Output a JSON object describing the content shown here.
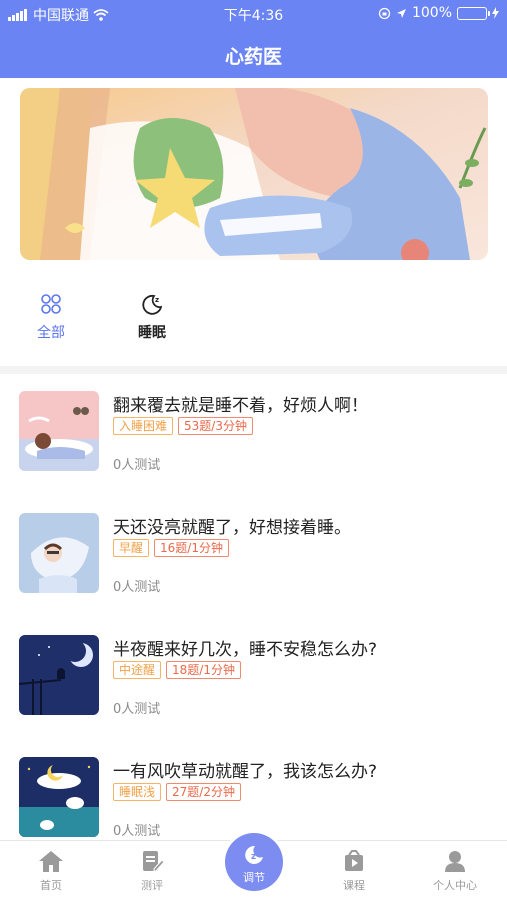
{
  "status_bar": {
    "carrier": "中国联通",
    "time": "下午4:36",
    "battery_percent": "100%",
    "battery_level": 1.0
  },
  "header": {
    "title": "心药医"
  },
  "categories": [
    {
      "label": "全部",
      "icon": "grid-icon",
      "active": true
    },
    {
      "label": "睡眠",
      "icon": "moon-icon",
      "active": false
    }
  ],
  "tests": [
    {
      "title": "翻来覆去就是睡不着，好烦人啊！",
      "tag": "入睡困难",
      "meta": "53题/3分钟",
      "takers": "0人测试",
      "thumb": "girl-sleeping"
    },
    {
      "title": "天还没亮就醒了，好想接着睡。",
      "tag": "早醒",
      "meta": "16题/1分钟",
      "takers": "0人测试",
      "thumb": "pillow"
    },
    {
      "title": "半夜醒来好几次，睡不安稳怎么办?",
      "tag": "中途醒",
      "meta": "18题/1分钟",
      "takers": "0人测试",
      "thumb": "night-cat"
    },
    {
      "title": "一有风吹草动就醒了，我该怎么办?",
      "tag": "睡眠浅",
      "meta": "27题/2分钟",
      "takers": "0人测试",
      "thumb": "sheep-moon"
    }
  ],
  "tabbar": {
    "home": "首页",
    "eval": "测评",
    "center": "调节",
    "course": "课程",
    "me": "个人中心"
  },
  "colors": {
    "brand": "#6a84f3",
    "active": "#5b76ee",
    "tag_category": "#f0a24a",
    "tag_meta": "#e86a4a"
  }
}
